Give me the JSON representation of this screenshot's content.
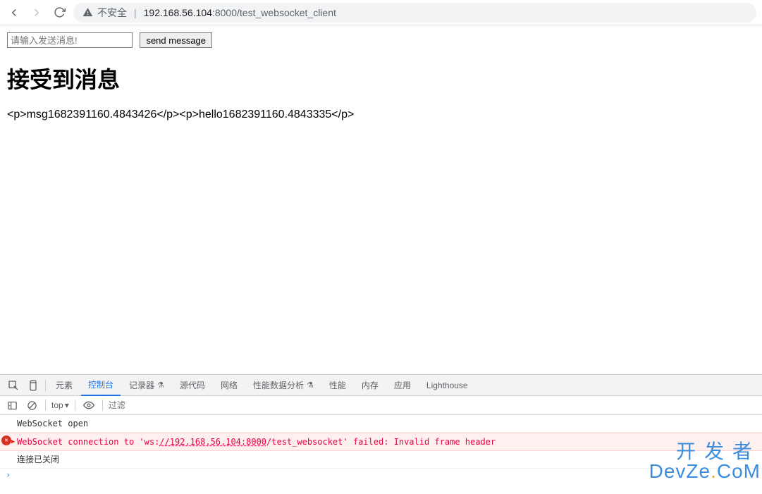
{
  "browser": {
    "insecure_label": "不安全",
    "url_host": "192.168.56.104",
    "url_port": ":8000",
    "url_path": "/test_websocket_client"
  },
  "page": {
    "input_placeholder": "请输入发送消息!",
    "send_button": "send message",
    "heading": "接受到消息",
    "received_html": "<p>msg1682391160.4843426</p><p>hello1682391160.4843335</p>"
  },
  "devtools": {
    "tabs": {
      "elements": "元素",
      "console": "控制台",
      "recorder": "记录器",
      "sources": "源代码",
      "network": "网络",
      "performance_insights": "性能数据分析",
      "performance": "性能",
      "memory": "内存",
      "application": "应用",
      "lighthouse": "Lighthouse"
    },
    "subbar": {
      "top": "top",
      "filter_placeholder": "过滤"
    },
    "console": {
      "line1": "WebSocket open",
      "error": {
        "pre": "WebSocket connection to 'ws:",
        "url": "//192.168.56.104:8000",
        "path": "/test_websocket",
        "tail": "' failed: Invalid frame header"
      },
      "line3": "连接已关闭"
    }
  },
  "watermark": {
    "line1": "开发者",
    "line2a": "DevZe",
    "line2b": "CoM"
  }
}
